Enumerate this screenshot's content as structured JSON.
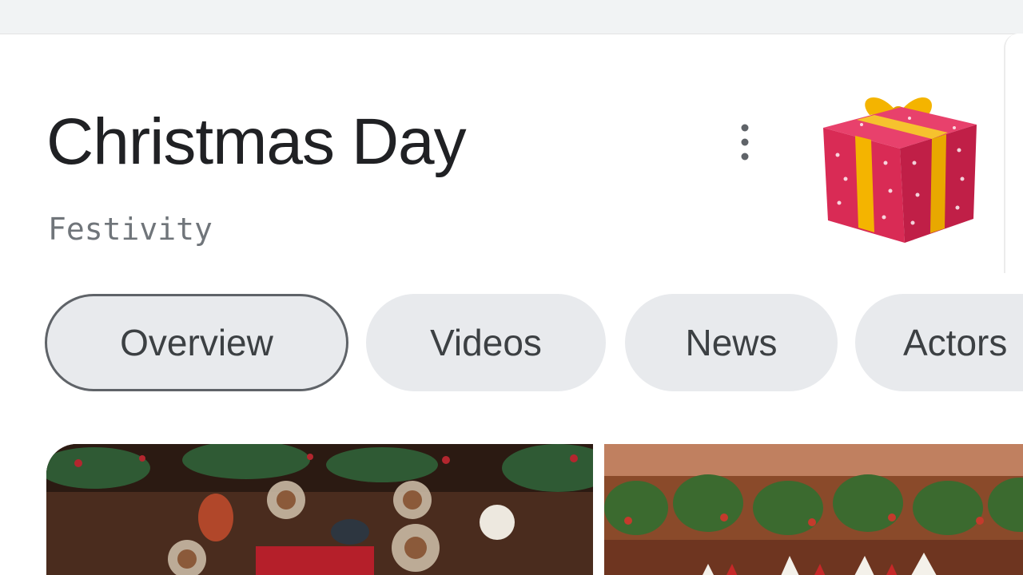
{
  "entity": {
    "title": "Christmas Day",
    "subtitle": "Festivity"
  },
  "icons": {
    "more": "more-vert-icon",
    "gift": "gift-icon"
  },
  "tabs": [
    {
      "label": "Overview",
      "selected": true
    },
    {
      "label": "Videos",
      "selected": false
    },
    {
      "label": "News",
      "selected": false
    },
    {
      "label": "Actors",
      "selected": false
    }
  ],
  "colors": {
    "title": "#202124",
    "subtitle": "#70757a",
    "chip_bg": "#e8eaed",
    "chip_border_selected": "#5f6368",
    "gift_box": "#d92b55",
    "gift_ribbon": "#f4b400"
  }
}
